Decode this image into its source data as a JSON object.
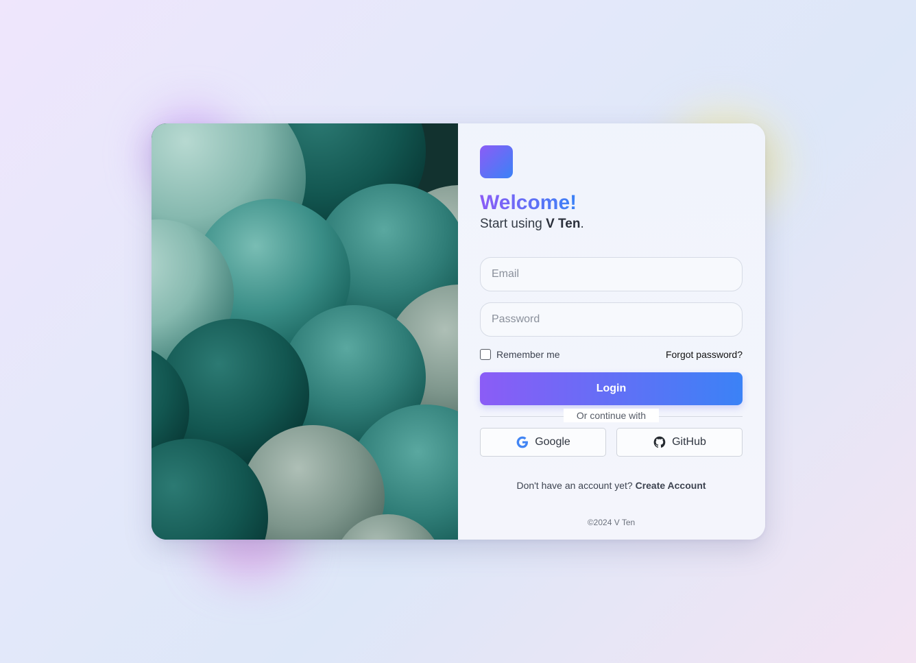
{
  "brand": {
    "name": "V Ten",
    "gradient_start": "#8b5cf6",
    "gradient_end": "#3b82f6"
  },
  "header": {
    "title": "Welcome!",
    "subtitle_prefix": "Start using",
    "subtitle_brand": "V Ten",
    "subtitle_suffix": "."
  },
  "form": {
    "email": {
      "placeholder": "Email",
      "value": ""
    },
    "password": {
      "placeholder": "Password",
      "value": ""
    },
    "remember_label": "Remember me",
    "remember_checked": false,
    "forgot_label": "Forgot password?",
    "login_label": "Login"
  },
  "divider_text": "Or continue with",
  "social": [
    {
      "label": "Google",
      "icon": "google-icon"
    },
    {
      "label": "GitHub",
      "icon": "github-icon"
    }
  ],
  "signup": {
    "prompt": "Don't have an account yet?",
    "link": "Create Account"
  },
  "footer": {
    "copyright": "©2024 V Ten"
  },
  "hero": {
    "icon": "teal-spheres-image",
    "colors": [
      "#0b3a37",
      "#1f6a64",
      "#3a8f88",
      "#7fb5ab",
      "#6f8f85"
    ]
  }
}
